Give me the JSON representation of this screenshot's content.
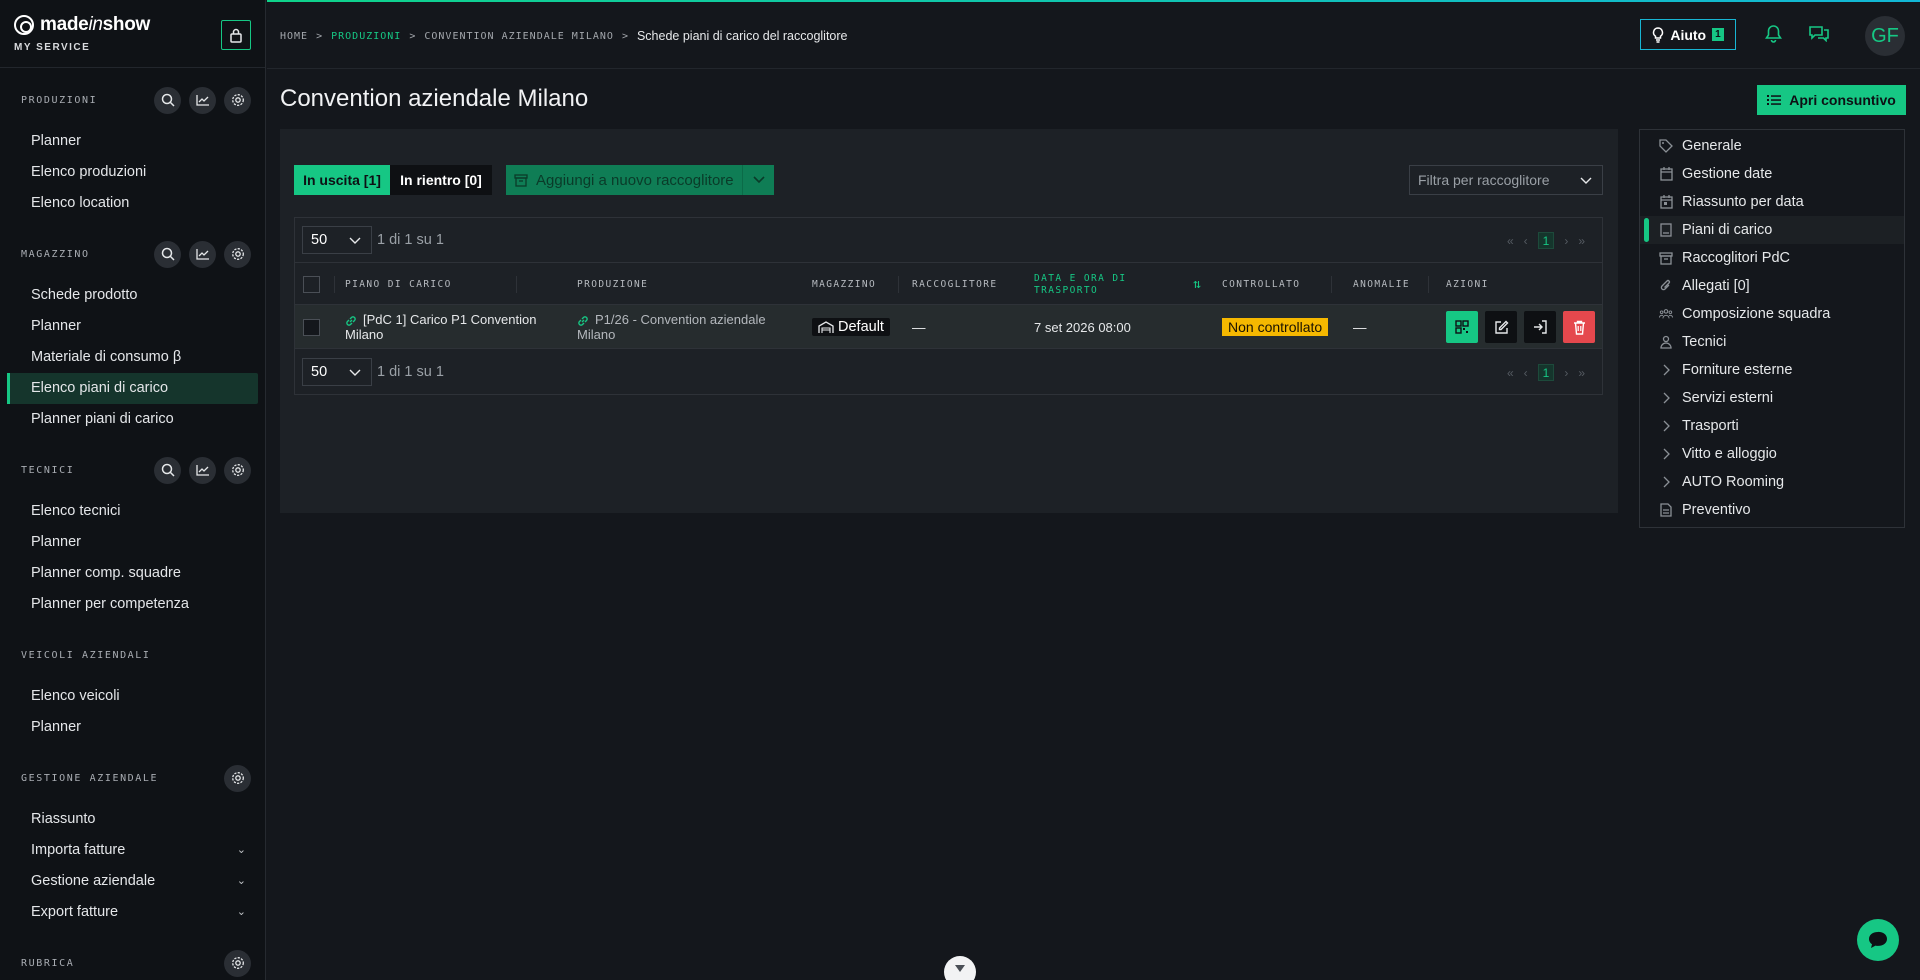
{
  "brand": {
    "logo_pre": "made",
    "logo_in": "in",
    "logo_post": "show",
    "service": "MY SERVICE"
  },
  "sidebar": {
    "sections": [
      {
        "title": "PRODUZIONI",
        "items": [
          "Planner",
          "Elenco produzioni",
          "Elenco location"
        ]
      },
      {
        "title": "MAGAZZINO",
        "items": [
          "Schede prodotto",
          "Planner",
          "Materiale di consumo β",
          "Elenco piani di carico",
          "Planner piani di carico"
        ]
      },
      {
        "title": "TECNICI",
        "items": [
          "Elenco tecnici",
          "Planner",
          "Planner comp. squadre",
          "Planner per competenza"
        ]
      },
      {
        "title": "VEICOLI AZIENDALI",
        "items": [
          "Elenco veicoli",
          "Planner"
        ]
      },
      {
        "title": "GESTIONE AZIENDALE",
        "items": [
          "Riassunto",
          "Importa fatture",
          "Gestione aziendale",
          "Export fatture"
        ]
      },
      {
        "title": "RUBRICA",
        "items": []
      }
    ],
    "active_item": "Elenco piani di carico"
  },
  "breadcrumb": {
    "home": "HOME",
    "produzioni": "PRODUZIONI",
    "convention": "CONVENTION AZIENDALE MILANO",
    "current": "Schede piani di carico del raccoglitore"
  },
  "header": {
    "help_label": "Aiuto",
    "help_count": "1",
    "avatar": "GF"
  },
  "page": {
    "title": "Convention aziendale Milano",
    "open_button": "Apri consuntivo"
  },
  "toolbar": {
    "tab_out": "In uscita [1]",
    "tab_in": "In rientro [0]",
    "add_label": "Aggiungi a nuovo raccoglitore",
    "filter_placeholder": "Filtra per raccoglitore"
  },
  "pagination": {
    "page_size": "50",
    "info": "1 di 1 su 1",
    "current_page": "1"
  },
  "table": {
    "columns": [
      "PIANO DI CARICO",
      "PRODUZIONE",
      "MAGAZZINO",
      "RACCOGLITORE",
      "DATA E ORA DI TRASPORTO",
      "CONTROLLATO",
      "ANOMALIE",
      "AZIONI"
    ],
    "rows": [
      {
        "piano_line1": "[PdC 1] Carico P1 Convention",
        "piano_line2": "Milano",
        "produzione_line1": "P1/26 - Convention aziendale",
        "produzione_line2": "Milano",
        "magazzino": "Default",
        "raccoglitore": "—",
        "data": "7 set 2026 08:00",
        "controllato": "Non controllato",
        "anomalie": "—"
      }
    ]
  },
  "side_menu": {
    "items": [
      "Generale",
      "Gestione date",
      "Riassunto per data",
      "Piani di carico",
      "Raccoglitori PdC",
      "Allegati [0]",
      "Composizione squadra",
      "Tecnici",
      "Forniture esterne",
      "Servizi esterni",
      "Trasporti",
      "Vitto e alloggio",
      "AUTO Rooming",
      "Preventivo"
    ],
    "active": "Piani di carico"
  },
  "colors": {
    "accent": "#16c784",
    "warning": "#f5b800",
    "danger": "#e5484d",
    "info": "#18b6d4"
  }
}
